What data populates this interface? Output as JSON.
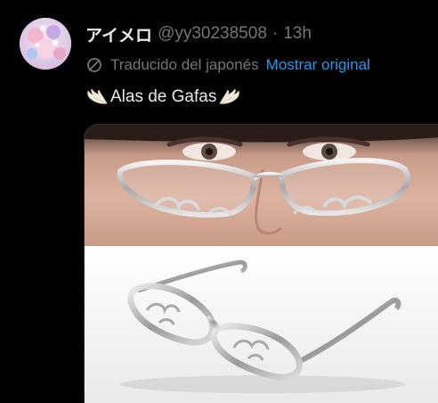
{
  "tweet": {
    "display_name": "アイメロ",
    "handle": "@yy30238508",
    "separator": "·",
    "time": "13h",
    "translation_label": "Traducido del japonés",
    "show_original_label": "Mostrar original",
    "text": "Alas de Gafas",
    "icons": {
      "avatar": "avatar",
      "translate": "translate-icon",
      "wing": "angel-wing-icon"
    },
    "colors": {
      "background": "#000000",
      "primary_text": "#e7e9ea",
      "secondary_text": "#71767b",
      "link": "#1d9bf0"
    }
  }
}
